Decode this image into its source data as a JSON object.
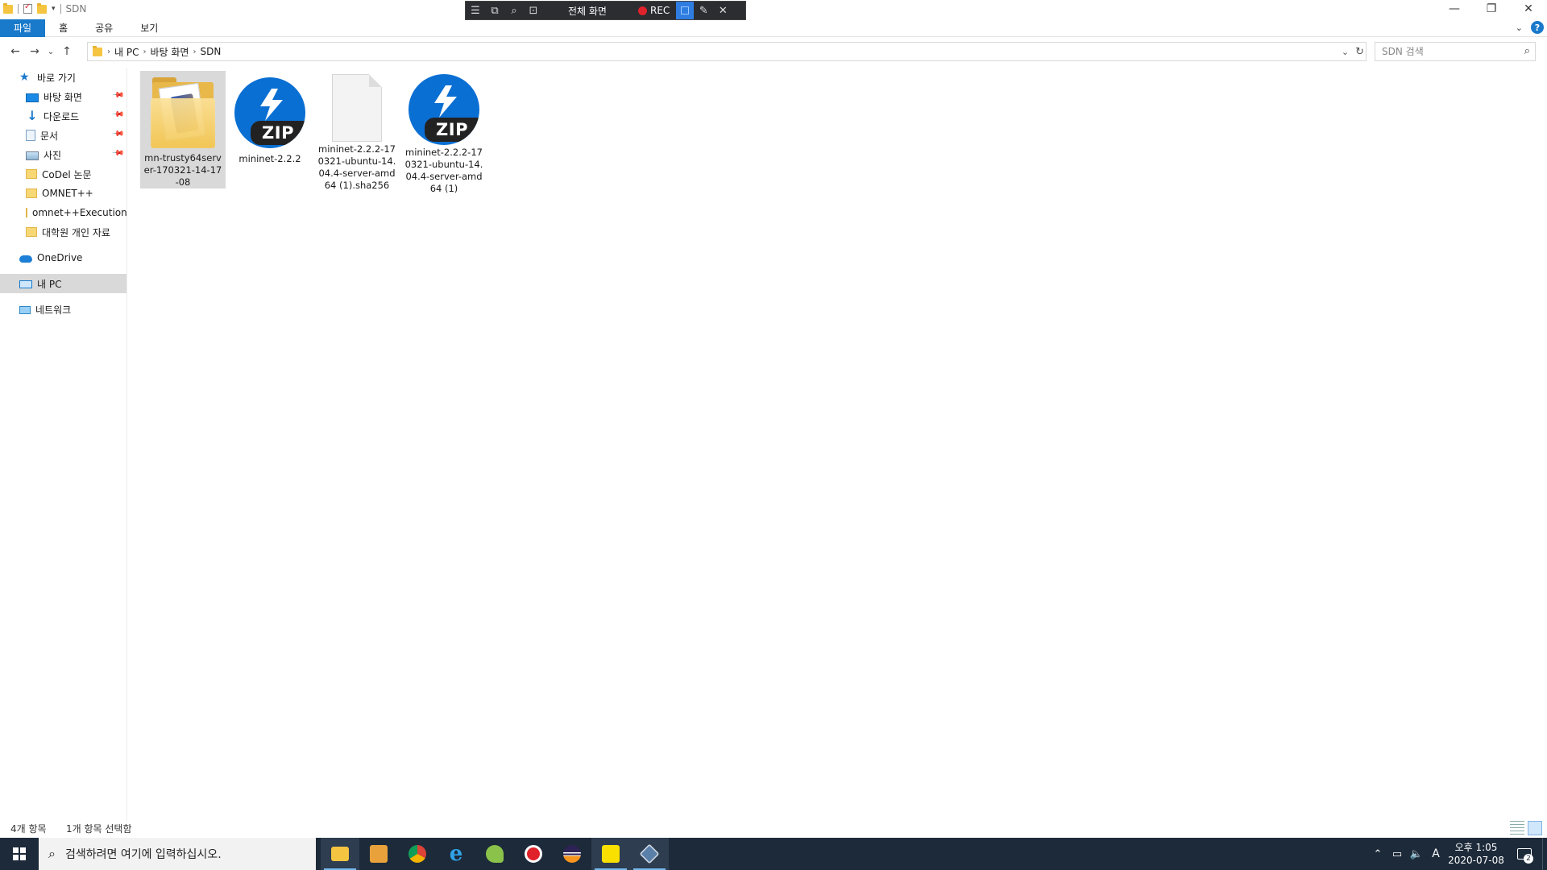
{
  "window": {
    "title": "SDN",
    "minimize": "—",
    "maximize": "❐",
    "close": "✕"
  },
  "recorder": {
    "mode_label": "전체 화면",
    "rec_label": "REC"
  },
  "ribbon": {
    "tabs": [
      "파일",
      "홈",
      "공유",
      "보기"
    ]
  },
  "address": {
    "crumbs": [
      "내 PC",
      "바탕 화면",
      "SDN"
    ],
    "search_placeholder": "SDN 검색"
  },
  "nav_pane": {
    "quick_access": "바로 가기",
    "pinned": [
      "바탕 화면",
      "다운로드",
      "문서",
      "사진"
    ],
    "folders": [
      "CoDel 논문",
      "OMNET++",
      "omnet++Execution",
      "대학원 개인 자료"
    ],
    "onedrive": "OneDrive",
    "this_pc": "내 PC",
    "network": "네트워크"
  },
  "files": [
    {
      "name": "mn-trusty64server-170321-14-17-08",
      "type": "folder",
      "icon": "folder-icon",
      "selected": true
    },
    {
      "name": "mininet-2.2.2",
      "type": "zip",
      "icon": "zip-icon",
      "zip_label": "ZIP",
      "selected": false
    },
    {
      "name": "mininet-2.2.2-170321-ubuntu-14.04.4-server-amd64 (1).sha256",
      "type": "file",
      "icon": "blank-file-icon",
      "selected": false
    },
    {
      "name": "mininet-2.2.2-170321-ubuntu-14.04.4-server-amd64 (1)",
      "type": "zip",
      "icon": "zip-icon",
      "zip_label": "ZIP",
      "selected": false
    }
  ],
  "status": {
    "item_count": "4개 항목",
    "selection": "1개 항목 선택함"
  },
  "taskbar": {
    "search_placeholder": "검색하려면 여기에 입력하십시오.",
    "ime": "A",
    "time_line1": "오후 1:05",
    "time_line2": "2020-07-08",
    "notifications": "2"
  },
  "colors": {
    "accent": "#1979ca",
    "taskbar": "#1d2a3a",
    "selection": "#d9d9d9",
    "zip_blue": "#0a6fd3"
  }
}
